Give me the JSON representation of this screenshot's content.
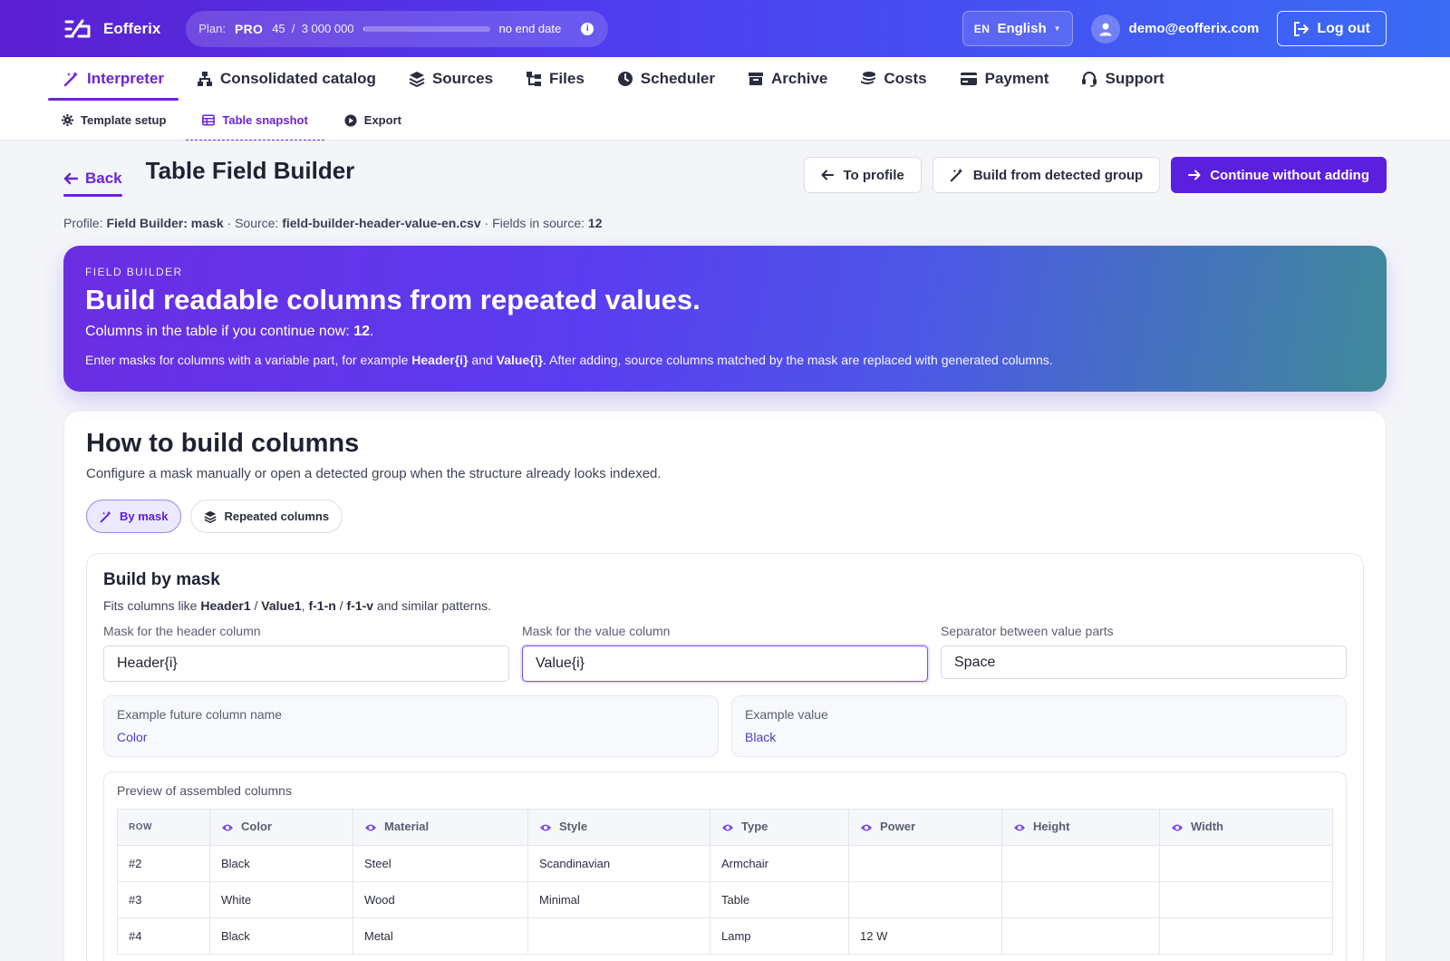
{
  "topbar": {
    "brand": "Eofferix",
    "plan_label": "Plan:",
    "plan_name": "PRO",
    "plan_usage": "45  /  3 000 000",
    "plan_progress": 2e-05,
    "plan_end": "no end date",
    "lang_code": "EN",
    "lang_name": "English",
    "user_email": "demo@eofferix.com",
    "logout_label": "Log out"
  },
  "nav": {
    "items": [
      {
        "label": "Interpreter"
      },
      {
        "label": "Consolidated catalog"
      },
      {
        "label": "Sources"
      },
      {
        "label": "Files"
      },
      {
        "label": "Scheduler"
      },
      {
        "label": "Archive"
      },
      {
        "label": "Costs"
      },
      {
        "label": "Payment"
      },
      {
        "label": "Support"
      }
    ],
    "active": "Interpreter"
  },
  "subnav": {
    "items": [
      {
        "label": "Template setup"
      },
      {
        "label": "Table snapshot"
      },
      {
        "label": "Export"
      }
    ],
    "active": "Table snapshot"
  },
  "header": {
    "back_label": "Back",
    "title": "Table Field Builder",
    "to_profile_label": "To profile",
    "build_group_label": "Build from detected group",
    "continue_label": "Continue without adding"
  },
  "meta": {
    "profile_label": "Profile:",
    "profile_value": "Field Builder: mask",
    "source_label": "Source:",
    "source_value": "field-builder-header-value-en.csv",
    "fields_label": "Fields in source:",
    "fields_value": "12"
  },
  "hero": {
    "kicker": "FIELD BUILDER",
    "title": "Build readable columns from repeated values.",
    "columns_text": "Columns in the table if you continue now:",
    "columns_value": "12",
    "desc_pre": "Enter masks for columns with a variable part, for example",
    "desc_mask1": "Header{i}",
    "desc_and": "and",
    "desc_mask2": "Value{i}",
    "desc_post": ". After adding, source columns matched by the mask are replaced with generated columns."
  },
  "howto": {
    "title": "How to build columns",
    "subtitle": "Configure a mask manually or open a detected group when the structure already looks indexed.",
    "mode_mask": "By mask",
    "mode_repeated": "Repeated columns"
  },
  "mask_panel": {
    "title": "Build by mask",
    "hint_pre": "Fits columns like",
    "hint_a": "Header1",
    "hint_slash1": " / ",
    "hint_b": "Value1",
    "hint_comma": ", ",
    "hint_c": "f-1-n",
    "hint_slash2": " / ",
    "hint_d": "f-1-v",
    "hint_post": "and similar patterns.",
    "header_mask_label": "Mask for the header column",
    "header_mask_value": "Header{i}",
    "value_mask_label": "Mask for the value column",
    "value_mask_value": "Value{i}",
    "separator_label": "Separator between value parts",
    "separator_value": "Space",
    "example_name_label": "Example future column name",
    "example_name_value": "Color",
    "example_value_label": "Example value",
    "example_value_value": "Black"
  },
  "preview": {
    "title": "Preview of assembled columns",
    "row_header": "ROW",
    "columns": [
      "Color",
      "Material",
      "Style",
      "Type",
      "Power",
      "Height",
      "Width"
    ],
    "rows": [
      [
        "#2",
        "Black",
        "Steel",
        "Scandinavian",
        "Armchair",
        "",
        "",
        ""
      ],
      [
        "#3",
        "White",
        "Wood",
        "Minimal",
        "Table",
        "",
        "",
        ""
      ],
      [
        "#4",
        "Black",
        "Metal",
        "",
        "Lamp",
        "12 W",
        "",
        ""
      ]
    ]
  },
  "colors": {
    "accent": "#6a24d8",
    "primary_button": "#5b1fe0",
    "topbar_start": "#5b1fd1",
    "topbar_end": "#3a6cf4"
  }
}
